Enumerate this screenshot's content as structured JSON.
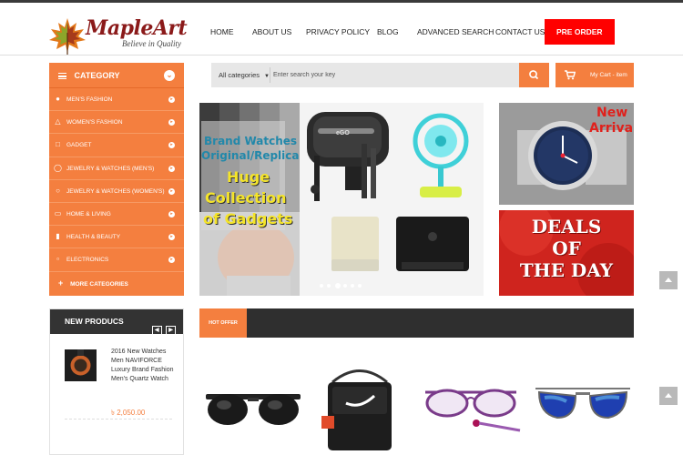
{
  "brand": {
    "name": "MapleArt",
    "tagline": "Believe in Quality"
  },
  "nav": [
    "HOME",
    "ABOUT US",
    "PRIVACY POLICY",
    "BLOG",
    "ADVANCED SEARCH",
    "CONTACT US"
  ],
  "preorder_label": "PRE ORDER",
  "category": {
    "title": "CATEGORY",
    "items": [
      "MEN'S FASHION",
      "WOMEN'S FASHION",
      "GADGET",
      "JEWELRY & WATCHES (MEN'S)",
      "JEWELRY & WATCHES (WOMEN'S)",
      "HOME & LIVING",
      "HEALTH & BEAUTY",
      "ELECTRONICS"
    ],
    "more": "MORE CATEGORIES"
  },
  "search": {
    "category": "All categories",
    "placeholder": "Enter search your key"
  },
  "cart": {
    "label": "My Cart - item"
  },
  "banner": {
    "line1": "Brand Watches",
    "line2": "Original/Replica",
    "line3": "Huge",
    "line4": "Collection",
    "line5": "of Gadgets",
    "case_label": "eGO"
  },
  "side_banner_1": {
    "line1": "New",
    "line2": "Arrival"
  },
  "side_banner_2": {
    "line1": "DEALS",
    "line2": "OF",
    "line3": "THE DAY"
  },
  "new_products": {
    "title": "NEW PRODUCS",
    "item": {
      "title": "2016 New Watches Men NAVIFORCE Luxury Brand Fashion Men's Quartz Watch",
      "price": "৳ 2,050.00"
    }
  },
  "hot_offer": {
    "label": "HOT OFFER"
  },
  "colors": {
    "accent": "#f47f3f",
    "preorder": "#ff0000",
    "dark": "#2f2f2f"
  }
}
